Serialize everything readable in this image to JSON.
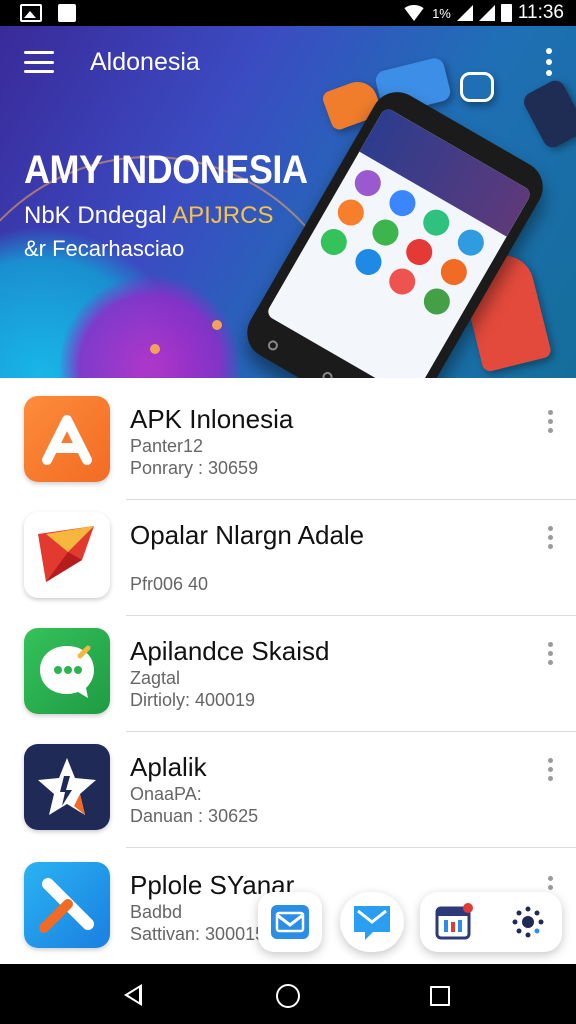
{
  "status_bar": {
    "battery_pct": "1%",
    "time": "11:36"
  },
  "app_bar": {
    "title": "Aldonesia"
  },
  "hero": {
    "title": "AMY INDONESIA",
    "subtitle_1_prefix": "NbK Dndegal ",
    "subtitle_1_highlight": "APIJRCS",
    "subtitle_2": "&r Fecarhasciao"
  },
  "apps": [
    {
      "name": "APK Inlonesia",
      "line1": "Panter12",
      "line2": "Ponrary : 30659",
      "icon": "a-letter-icon",
      "color": "#f4772a"
    },
    {
      "name": "Opalar Nlargn Adale",
      "line1": "",
      "line2": "Pfr006 40",
      "icon": "play-arrow-icon",
      "color": "#e23a2e"
    },
    {
      "name": "Apilandce Skaisd",
      "line1": "Zagtal",
      "line2": "Dirtioly: 400019",
      "icon": "chat-bubble-icon",
      "color": "#2bb54f"
    },
    {
      "name": "Aplalik",
      "line1": "OnaaPA:",
      "line2": "Danuan : 30625",
      "icon": "star-icon",
      "color": "#1f2a56"
    },
    {
      "name": "Pplole SYanar",
      "line1": "Badbd",
      "line2": "Sattivan: 300015",
      "icon": "pen-icon",
      "color": "#1f8ae6"
    }
  ],
  "quick_actions": [
    {
      "icon": "mail-image-icon"
    },
    {
      "icon": "message-icon"
    },
    {
      "icon": "calendar-icon",
      "badge_color": "#e53935"
    },
    {
      "icon": "settings-dots-icon"
    }
  ],
  "colors": {
    "hero_start": "#3a2a9a",
    "hero_end": "#146e9a",
    "accent": "#f7c24a"
  }
}
